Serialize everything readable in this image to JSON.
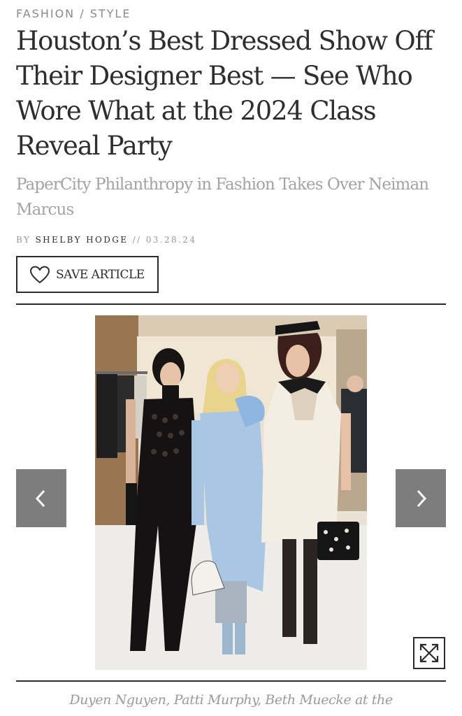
{
  "category": "FASHION / STYLE",
  "headline": "Houston’s Best Dressed Show Off Their Designer Best — See Who Wore What at the 2024 Class Reveal Party",
  "subhead": "PaperCity Philanthropy in Fashion Takes Over Neiman Marcus",
  "byline": {
    "by": "BY",
    "author": "SHELBY HODGE",
    "separator": "//",
    "date": "03.28.24"
  },
  "save_button": {
    "label": "SAVE ARTICLE",
    "icon": "heart-icon"
  },
  "gallery": {
    "prev_icon": "chevron-left-icon",
    "next_icon": "chevron-right-icon",
    "expand_icon": "expand-icon"
  },
  "caption": "Duyen Nguyen, Patti Murphy, Beth Muecke at the",
  "colors": {
    "text": "#2b2b2b",
    "muted": "#a3a3a3",
    "nav_bg": "#7d7d7d"
  }
}
